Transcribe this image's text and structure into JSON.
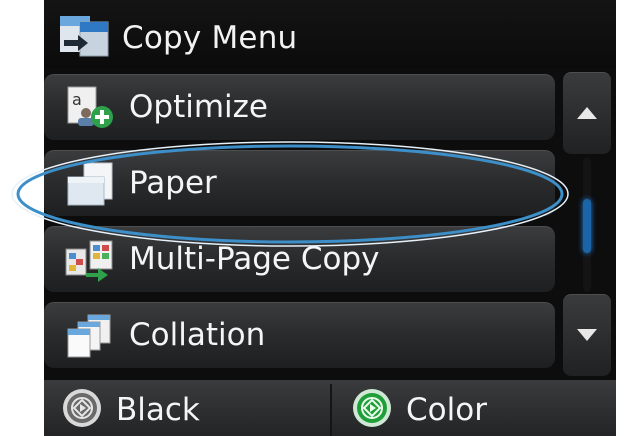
{
  "header": {
    "title": "Copy Menu",
    "icon": "copy-icon"
  },
  "menu": {
    "items": [
      {
        "label": "Optimize",
        "icon": "optimize-icon"
      },
      {
        "label": "Paper",
        "icon": "paper-icon",
        "highlighted": true
      },
      {
        "label": "Multi-Page Copy",
        "icon": "multi-page-copy-icon"
      },
      {
        "label": "Collation",
        "icon": "collation-icon"
      }
    ]
  },
  "scrollbar": {
    "up": "scroll-up-arrow",
    "down": "scroll-down-arrow",
    "accent": "#1c64a8"
  },
  "bottom_bar": {
    "black": {
      "label": "Black",
      "icon": "start-copy-icon",
      "color": "#5a5a5a"
    },
    "color": {
      "label": "Color",
      "icon": "start-copy-icon",
      "color": "#1f9e3a"
    }
  },
  "colors": {
    "callout": "#3c8fc8",
    "background": "#0d0d0e"
  }
}
